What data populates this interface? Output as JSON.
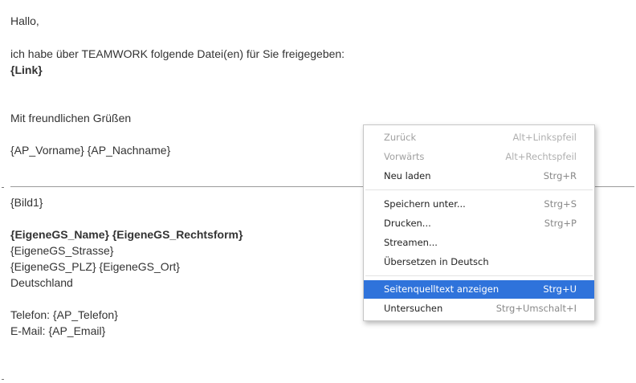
{
  "email": {
    "greeting": "Hallo,",
    "intro": "ich habe über TEAMWORK folgende Datei(en) für Sie freigegeben:",
    "link": "{Link}",
    "closing": "Mit freundlichen Grüßen",
    "sender": "{AP_Vorname} {AP_Nachname}",
    "image": "{Bild1}",
    "company_name": "{EigeneGS_Name} {EigeneGS_Rechtsform}",
    "street": "{EigeneGS_Strasse}",
    "zip_city": "{EigeneGS_PLZ} {EigeneGS_Ort}",
    "country": "Deutschland",
    "phone": "Telefon: {AP_Telefon}",
    "mail": "E-Mail: {AP_Email}"
  },
  "context_menu": {
    "items": [
      {
        "label": "Zurück",
        "shortcut": "Alt+Linkspfeil",
        "disabled": true
      },
      {
        "label": "Vorwärts",
        "shortcut": "Alt+Rechtspfeil",
        "disabled": true
      },
      {
        "label": "Neu laden",
        "shortcut": "Strg+R"
      },
      {
        "label": "Speichern unter...",
        "shortcut": "Strg+S"
      },
      {
        "label": "Drucken...",
        "shortcut": "Strg+P"
      },
      {
        "label": "Streamen...",
        "shortcut": ""
      },
      {
        "label": "Übersetzen in Deutsch",
        "shortcut": ""
      },
      {
        "label": "Seitenquelltext anzeigen",
        "shortcut": "Strg+U",
        "highlighted": true
      },
      {
        "label": "Untersuchen",
        "shortcut": "Strg+Umschalt+I"
      }
    ]
  },
  "colors": {
    "highlight": "#2f73db",
    "text": "#333333",
    "divider": "#9a9a9a"
  }
}
